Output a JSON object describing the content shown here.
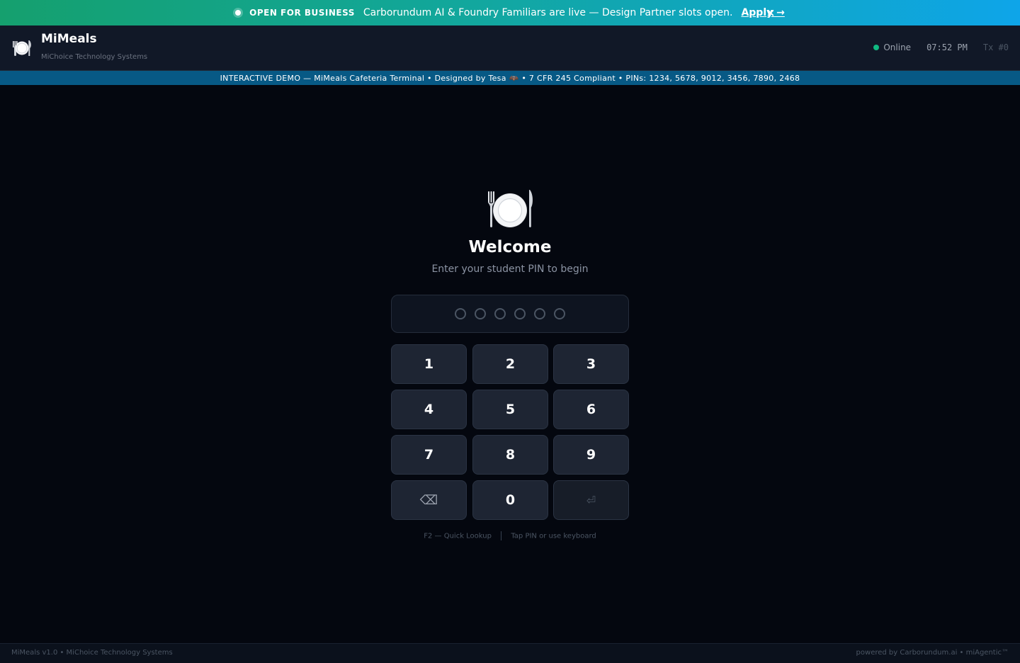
{
  "promo": {
    "tag": "OPEN FOR BUSINESS",
    "message": "Carborundum AI & Foundry Familiars are live — Design Partner slots open.",
    "link": "Apply →",
    "close": "×"
  },
  "header": {
    "app_name": "MiMeals",
    "app_subtitle": "MiChoice Technology Systems",
    "status": "Online",
    "time": "07:52 PM",
    "transaction": "Tx #0",
    "logo_icon": "plate-utensils-icon"
  },
  "demo_banner": {
    "text": "INTERACTIVE DEMO — MiMeals Cafeteria Terminal • Designed by Tesa 🦇 • 7 CFR 245 Compliant • PINs: 1234, 5678, 9012, 3456, 7890, 2468"
  },
  "welcome": {
    "icon": "plate-utensils-icon",
    "title": "Welcome",
    "subtitle": "Enter your student PIN to begin"
  },
  "pin": {
    "length": 6,
    "entered": 0
  },
  "keypad": {
    "keys": [
      "1",
      "2",
      "3",
      "4",
      "5",
      "6",
      "7",
      "8",
      "9",
      "⌫",
      "0",
      "⏎"
    ]
  },
  "hints": {
    "left": "F2 — Quick Lookup",
    "right": "Tap PIN or use keyboard"
  },
  "footer": {
    "left": "MiMeals v1.0 • MiChoice Technology Systems",
    "right": "powered by Carborundum.ai • miAgentic™"
  },
  "colors": {
    "accent_green": "#10b981",
    "banner_gradient_start": "#15a06e",
    "banner_gradient_end": "#0ea5e9",
    "demo_strip": "#075985",
    "background": "#04070f"
  }
}
